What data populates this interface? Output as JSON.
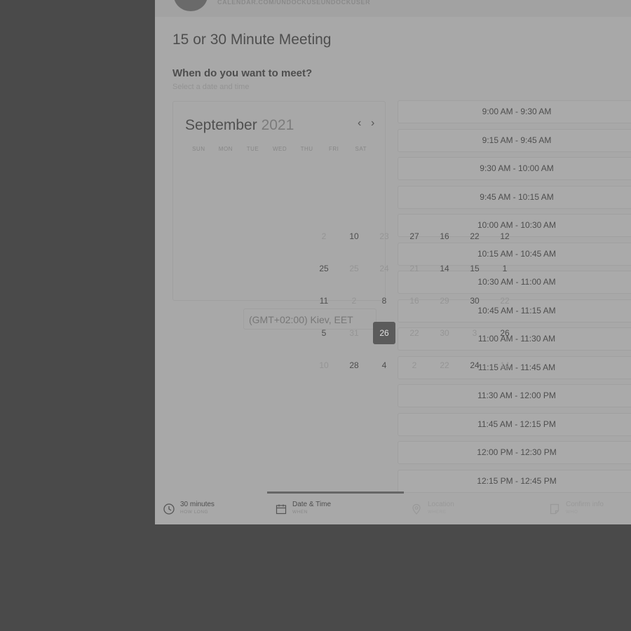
{
  "header": {
    "url": "CALENDAR.COM/UNDOCKUSEUNDOCKUSER"
  },
  "page_title": "15 or 30 Minute Meeting",
  "section": {
    "title": "When do you want to meet?",
    "subtitle": "Select a date and time"
  },
  "calendar": {
    "month": "September",
    "year": "2021",
    "prev_icon": "‹",
    "next_icon": "›",
    "weekdays": [
      "SUN",
      "MON",
      "TUE",
      "WED",
      "THU",
      "FRI",
      "SAT"
    ],
    "selected_day": "26",
    "days": [
      {
        "label": "2",
        "dim": true
      },
      {
        "label": "10",
        "dim": false
      },
      {
        "label": "23",
        "dim": true
      },
      {
        "label": "27",
        "dim": false
      },
      {
        "label": "16",
        "dim": false
      },
      {
        "label": "22",
        "dim": false
      },
      {
        "label": "12",
        "dim": false
      },
      {
        "label": "25",
        "dim": false
      },
      {
        "label": "25",
        "dim": true
      },
      {
        "label": "24",
        "dim": true
      },
      {
        "label": "21",
        "dim": true
      },
      {
        "label": "14",
        "dim": false
      },
      {
        "label": "15",
        "dim": false
      },
      {
        "label": "1",
        "dim": false
      },
      {
        "label": "11",
        "dim": false
      },
      {
        "label": "2",
        "dim": true
      },
      {
        "label": "8",
        "dim": false
      },
      {
        "label": "16",
        "dim": true
      },
      {
        "label": "29",
        "dim": true
      },
      {
        "label": "30",
        "dim": false
      },
      {
        "label": "22",
        "dim": true
      },
      {
        "label": "5",
        "dim": false
      },
      {
        "label": "31",
        "dim": true
      },
      {
        "label": "26",
        "dim": false
      },
      {
        "label": "22",
        "dim": true
      },
      {
        "label": "30",
        "dim": true
      },
      {
        "label": "3",
        "dim": true
      },
      {
        "label": "26",
        "dim": false
      },
      {
        "label": "10",
        "dim": true
      },
      {
        "label": "28",
        "dim": false
      },
      {
        "label": "4",
        "dim": false
      },
      {
        "label": "2",
        "dim": true
      },
      {
        "label": "22",
        "dim": true
      },
      {
        "label": "24",
        "dim": false
      },
      {
        "label": "14",
        "dim": true
      }
    ]
  },
  "timezone": "(GMT+02:00) Kiev, EET",
  "time_slots": [
    "9:00 AM - 9:30 AM",
    "9:15 AM - 9:45 AM",
    "9:30 AM - 10:00 AM",
    "9:45 AM - 10:15 AM",
    "10:00 AM - 10:30 AM",
    "10:15 AM - 10:45 AM",
    "10:30 AM - 11:00 AM",
    "10:45 AM - 11:15 AM",
    "11:00 AM - 11:30 AM",
    "11:15 AM - 11:45 AM",
    "11:30 AM - 12:00 PM",
    "11:45 AM - 12:15 PM",
    "12:00 PM - 12:30 PM",
    "12:15 PM - 12:45 PM"
  ],
  "footer_steps": [
    {
      "label": "30 minutes",
      "sub": "HOW LONG",
      "icon": "clock-icon"
    },
    {
      "label": "Date & Time",
      "sub": "WHEN",
      "icon": "calendar-icon"
    },
    {
      "label": "Location",
      "sub": "WHERE",
      "icon": "location-pin-icon"
    },
    {
      "label": "Confirm info",
      "sub": "WHO",
      "icon": "document-icon"
    }
  ]
}
